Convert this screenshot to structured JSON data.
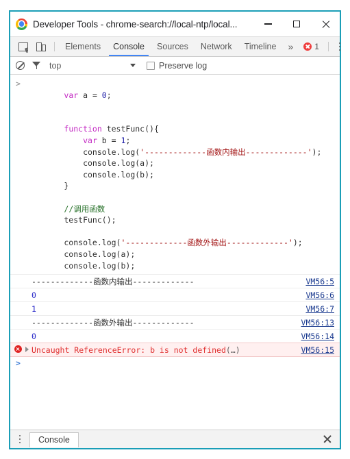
{
  "window": {
    "title": "Developer Tools - chrome-search://local-ntp/local...",
    "logo_icon": "chrome-logo",
    "minimize_icon": "minimize-icon",
    "maximize_icon": "maximize-icon",
    "close_icon": "close-icon"
  },
  "toolbar": {
    "inspect_icon": "inspect-element-icon",
    "device_icon": "device-toolbar-icon",
    "tabs": [
      {
        "label": "Elements",
        "active": false
      },
      {
        "label": "Console",
        "active": true
      },
      {
        "label": "Sources",
        "active": false
      },
      {
        "label": "Network",
        "active": false
      },
      {
        "label": "Timeline",
        "active": false
      }
    ],
    "more_tabs_icon": "chevron-double-right-icon",
    "more_tabs_glyph": "»",
    "error_icon": "error-circle-icon",
    "error_count": "1",
    "menu_icon": "vertical-dots-icon"
  },
  "filterbar": {
    "clear_icon": "clear-console-icon",
    "filter_icon": "filter-funnel-icon",
    "context": "top",
    "context_caret_icon": "chevron-down-icon",
    "preserve_log_label": "Preserve log",
    "preserve_log_checked": false
  },
  "console": {
    "input_prompt": ">",
    "code_lines": [
      {
        "prompt": ">",
        "segments": [
          {
            "t": "var",
            "c": "kw"
          },
          {
            "t": " a = "
          },
          {
            "t": "0",
            "c": "num"
          },
          {
            "t": ";"
          }
        ]
      },
      {
        "segments": [
          {
            "t": ""
          }
        ]
      },
      {
        "segments": [
          {
            "t": "        "
          },
          {
            "t": "function",
            "c": "kw"
          },
          {
            "t": " testFunc(){"
          }
        ]
      },
      {
        "segments": [
          {
            "t": "            "
          },
          {
            "t": "var",
            "c": "kw"
          },
          {
            "t": " b = "
          },
          {
            "t": "1",
            "c": "num"
          },
          {
            "t": ";"
          }
        ]
      },
      {
        "segments": [
          {
            "t": "            console.log("
          },
          {
            "t": "'-------------函数内输出-------------'",
            "c": "str"
          },
          {
            "t": ");"
          }
        ]
      },
      {
        "segments": [
          {
            "t": "            console.log(a);"
          }
        ]
      },
      {
        "segments": [
          {
            "t": "            console.log(b);"
          }
        ]
      },
      {
        "segments": [
          {
            "t": "        }"
          }
        ]
      },
      {
        "segments": [
          {
            "t": ""
          }
        ]
      },
      {
        "segments": [
          {
            "t": "        "
          },
          {
            "t": "//调用函数",
            "c": "cmt"
          }
        ]
      },
      {
        "segments": [
          {
            "t": "        testFunc();"
          }
        ]
      },
      {
        "segments": [
          {
            "t": ""
          }
        ]
      },
      {
        "segments": [
          {
            "t": "        console.log("
          },
          {
            "t": "'-------------函数外输出-------------'",
            "c": "str"
          },
          {
            "t": ");"
          }
        ]
      },
      {
        "segments": [
          {
            "t": "        console.log(a);"
          }
        ]
      },
      {
        "segments": [
          {
            "t": "        console.log(b);"
          }
        ]
      }
    ],
    "output_rows": [
      {
        "message": "-------------函数内输出-------------",
        "source": "VM56:5",
        "kind": "log"
      },
      {
        "message": "0",
        "source": "VM56:6",
        "kind": "value"
      },
      {
        "message": "1",
        "source": "VM56:7",
        "kind": "value"
      },
      {
        "message": "-------------函数外输出-------------",
        "source": "VM56:13",
        "kind": "log"
      },
      {
        "message": "0",
        "source": "VM56:14",
        "kind": "value"
      },
      {
        "message": "Uncaught ReferenceError: b is not defined",
        "message_suffix": "(…)",
        "source": "VM56:15",
        "kind": "error"
      }
    ]
  },
  "drawer": {
    "menu_icon": "vertical-dots-icon",
    "tab_label": "Console",
    "close_icon": "close-icon"
  },
  "colors": {
    "window_border": "#1a9eb7",
    "tab_active_underline": "#4285f4",
    "error_red": "#e02f2f",
    "error_row_bg": "#fff0f0",
    "link_blue": "#1a3a8f",
    "keyword_purple": "#c329c3",
    "number_blue": "#1a1aa6",
    "string_red": "#a31515",
    "comment_green": "#236e25"
  }
}
